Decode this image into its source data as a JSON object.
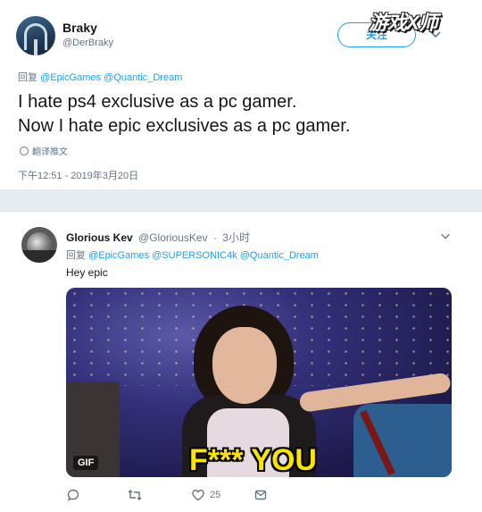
{
  "watermark": "游戏X师",
  "tweet1": {
    "display_name": "Braky",
    "handle": "@DerBraky",
    "follow_label": "关注",
    "reply_prefix": "回复",
    "mentions": [
      "@EpicGames",
      "@Quantic_Dream"
    ],
    "text_lines": [
      "I hate ps4 exclusive as a pc gamer.",
      "Now I hate epic exclusives as a pc gamer."
    ],
    "translate_label": "翻译推文",
    "timestamp": "下午12:51 - 2019年3月20日"
  },
  "tweet2": {
    "display_name": "Glorious Kev",
    "handle": "@GloriousKev",
    "time": "3小时",
    "reply_prefix": "回复",
    "mentions": [
      "@EpicGames",
      "@SUPERSONIC4k",
      "@Quantic_Dream"
    ],
    "text": "Hey epic",
    "media": {
      "badge": "GIF",
      "caption": "F*** YOU"
    },
    "actions": {
      "like_count": "25"
    }
  },
  "colors": {
    "link": "#1da1f2",
    "muted": "#657786",
    "text": "#14171a",
    "background": "#e6ecf0",
    "caption": "#fbe400"
  },
  "icons": [
    "chevron-down-icon",
    "globe-icon",
    "reply-icon",
    "retweet-icon",
    "like-icon",
    "message-icon"
  ]
}
